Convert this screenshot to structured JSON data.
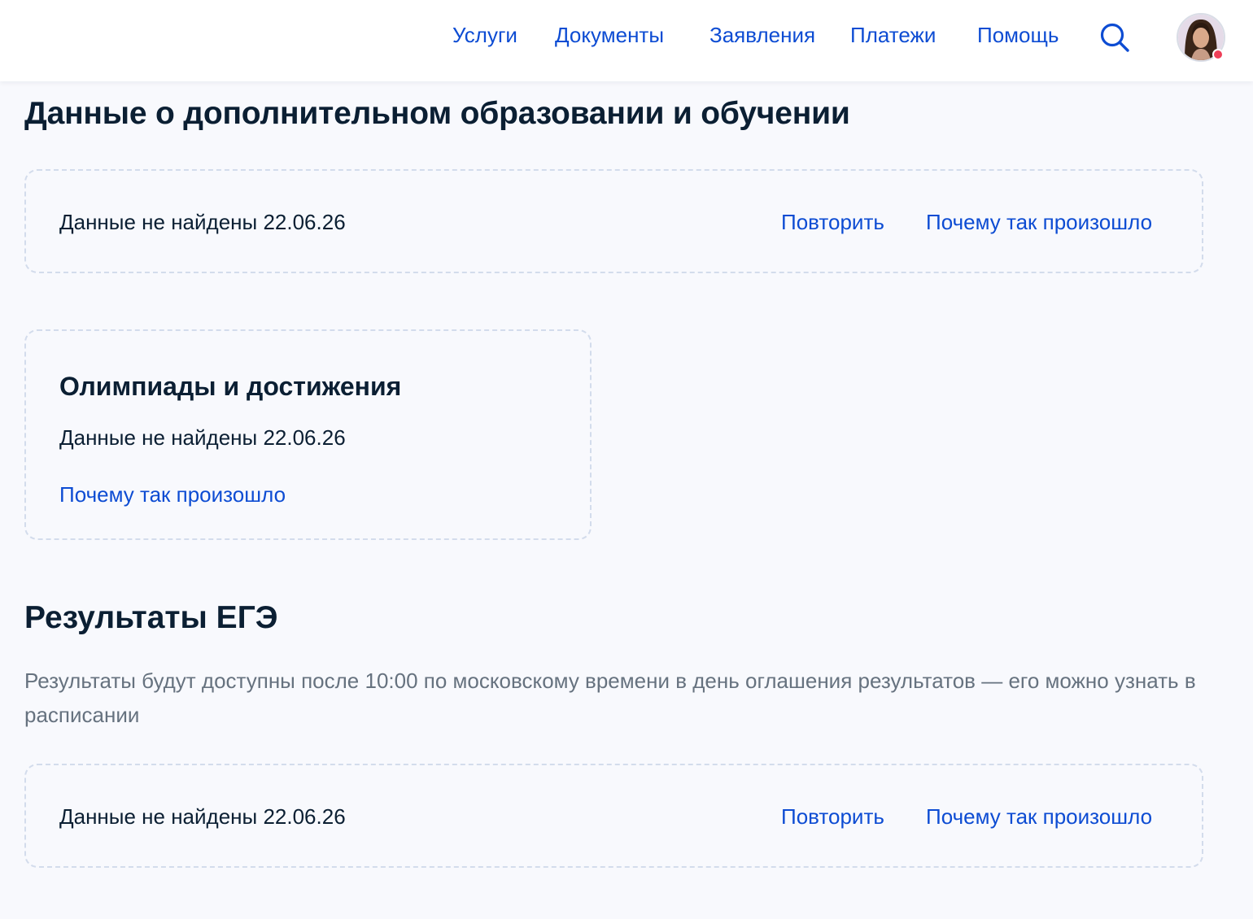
{
  "colors": {
    "accent": "#0d4cd3",
    "text": "#0b1f33",
    "muted": "#66727f",
    "background": "#f8f9fd",
    "notification": "#ee3f58"
  },
  "header": {
    "nav": [
      "Услуги",
      "Документы",
      "Заявления",
      "Платежи",
      "Помощь"
    ],
    "search_icon": "search-icon",
    "avatar_icon": "user-avatar"
  },
  "education": {
    "title": "Данные о дополнительном образовании и обучении",
    "status": "Данные не найдены 22.06.26",
    "retry_label": "Повторить",
    "why_label": "Почему так произошло"
  },
  "olympiads": {
    "title": "Олимпиады и достижения",
    "status": "Данные не найдены 22.06.26",
    "why_label": "Почему так произошло"
  },
  "ege": {
    "title": "Результаты ЕГЭ",
    "description": "Результаты будут доступны после 10:00 по московскому времени в день оглашения результатов — его можно узнать в расписании",
    "status": "Данные не найдены 22.06.26",
    "retry_label": "Повторить",
    "why_label": "Почему так произошло"
  }
}
